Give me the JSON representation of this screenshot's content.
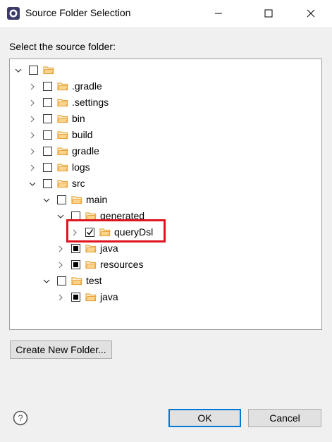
{
  "window": {
    "title": "Source Folder Selection"
  },
  "prompt": "Select the source folder:",
  "tree": [
    {
      "label": "",
      "level": 0,
      "expanded": true,
      "check": "none"
    },
    {
      "label": ".gradle",
      "level": 1,
      "expanded": false,
      "check": "none"
    },
    {
      "label": ".settings",
      "level": 1,
      "expanded": false,
      "check": "none"
    },
    {
      "label": "bin",
      "level": 1,
      "expanded": false,
      "check": "none"
    },
    {
      "label": "build",
      "level": 1,
      "expanded": false,
      "check": "none"
    },
    {
      "label": "gradle",
      "level": 1,
      "expanded": false,
      "check": "none"
    },
    {
      "label": "logs",
      "level": 1,
      "expanded": false,
      "check": "none"
    },
    {
      "label": "src",
      "level": 1,
      "expanded": true,
      "check": "none"
    },
    {
      "label": "main",
      "level": 2,
      "expanded": true,
      "check": "none"
    },
    {
      "label": "generated",
      "level": 3,
      "expanded": true,
      "check": "none"
    },
    {
      "label": "queryDsl",
      "level": 4,
      "expanded": false,
      "check": "checked"
    },
    {
      "label": "java",
      "level": 3,
      "expanded": false,
      "check": "partial"
    },
    {
      "label": "resources",
      "level": 3,
      "expanded": false,
      "check": "partial"
    },
    {
      "label": "test",
      "level": 2,
      "expanded": true,
      "check": "none"
    },
    {
      "label": "java",
      "level": 3,
      "expanded": false,
      "check": "partial"
    }
  ],
  "buttons": {
    "create_folder": "Create New Folder...",
    "ok": "OK",
    "cancel": "Cancel"
  },
  "colors": {
    "highlight": "#e0141e",
    "folder": "#e8a33c",
    "accent": "#0078d7"
  }
}
